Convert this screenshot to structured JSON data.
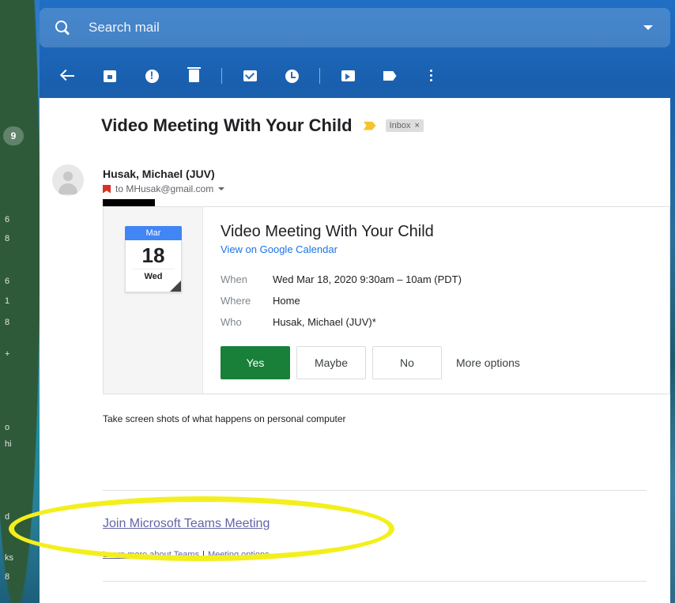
{
  "search": {
    "placeholder": "Search mail"
  },
  "left_strip": {
    "badge": "9",
    "glyphs": [
      "6",
      "8",
      "6",
      "1",
      "8",
      "+",
      "o",
      "hi",
      "d",
      "ks",
      "8"
    ]
  },
  "toolbar": {
    "icons": [
      "back-icon",
      "archive-icon",
      "spam-icon",
      "delete-icon",
      "mark-unread-icon",
      "snooze-icon",
      "move-to-icon",
      "label-icon",
      "more-icon"
    ]
  },
  "email": {
    "subject": "Video Meeting With Your Child",
    "inbox_label": "Inbox",
    "chip_close": "×",
    "sender": "Husak, Michael (JUV)",
    "to_line": "to MHusak@gmail.com",
    "body": "Take screen shots of what happens on personal computer"
  },
  "invite": {
    "month": "Mar",
    "day": "18",
    "weekday": "Wed",
    "title": "Video Meeting With Your Child",
    "calendar_link": "View on Google Calendar",
    "rows": [
      {
        "label": "When",
        "value": "Wed Mar 18, 2020 9:30am – 10am (PDT)"
      },
      {
        "label": "Where",
        "value": "Home"
      },
      {
        "label": "Who",
        "value": "Husak, Michael (JUV)*"
      }
    ],
    "buttons": {
      "yes": "Yes",
      "maybe": "Maybe",
      "no": "No",
      "more": "More options"
    }
  },
  "teams": {
    "join_link": "Join Microsoft Teams Meeting",
    "learn_more": "Learn more about Teams",
    "separator": "|",
    "meeting_options": "Meeting options"
  },
  "colors": {
    "accent_green": "#188038",
    "link_blue": "#1a73e8",
    "teams_purple": "#6264a7",
    "highlight_yellow": "#f3ef1c",
    "calendar_blue": "#4285f4"
  }
}
